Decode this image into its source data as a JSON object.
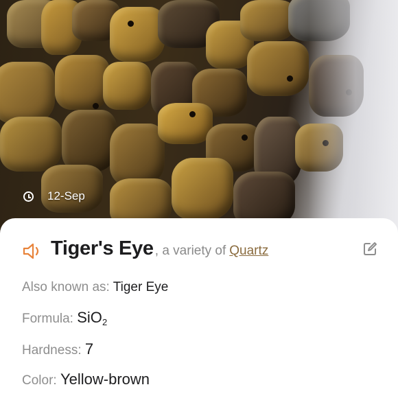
{
  "photo": {
    "timestamp": "12-Sep",
    "subject": "tiger-eye-chips",
    "icons": {
      "timestamp": "clock-icon"
    }
  },
  "detail": {
    "name": "Tiger's Eye",
    "variety_prefix": ", a variety of",
    "variety_link": "Quartz",
    "icons": {
      "audio": "speaker-icon",
      "edit": "edit-icon"
    },
    "accent_color": "#e8833a",
    "link_color": "#8a6b3e",
    "properties": [
      {
        "label": "Also known as:",
        "value": "Tiger Eye"
      },
      {
        "label": "Formula:",
        "value_main": "SiO",
        "value_sub": "2"
      },
      {
        "label": "Hardness:",
        "value": "7"
      },
      {
        "label": "Color:",
        "value": "Yellow-brown"
      }
    ]
  }
}
